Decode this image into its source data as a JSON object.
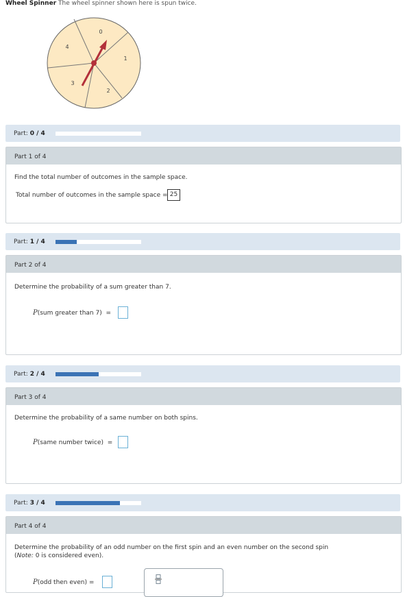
{
  "intro": {
    "title": "Wheel Spinner",
    "description": "The wheel spinner shown here is spun twice."
  },
  "spinner": {
    "numbers": [
      "0",
      "1",
      "2",
      "3",
      "4"
    ],
    "fill_color": "#fde9c3",
    "arrow_color": "#b3303a"
  },
  "progress": [
    {
      "label": "Part:",
      "value": "0 / 4",
      "fraction": 0
    },
    {
      "label": "Part:",
      "value": "1 / 4",
      "fraction": 0.25
    },
    {
      "label": "Part:",
      "value": "2 / 4",
      "fraction": 0.5
    },
    {
      "label": "Part:",
      "value": "3 / 4",
      "fraction": 0.75
    }
  ],
  "parts": [
    {
      "title": "Part 1 of 4",
      "question": "Find the total number of outcomes in the sample space.",
      "answer_label": "Total number of outcomes in the sample space =",
      "answer_value": "25"
    },
    {
      "title": "Part 2 of 4",
      "question": "Determine the probability of a sum greater than 7.",
      "prob_p": "P",
      "prob_arg": "(sum greater than 7)",
      "prob_eq": "="
    },
    {
      "title": "Part 3 of 4",
      "question": "Determine the probability of a same number on both spins.",
      "prob_p": "P",
      "prob_arg": "(same number twice)",
      "prob_eq": "="
    },
    {
      "title": "Part 4 of 4",
      "question": "Determine the probability of an odd number on the first spin and an even number on the second spin",
      "note_open": "(",
      "note_label": "Note:",
      "note_text": "0 is considered even).",
      "prob_p": "P",
      "prob_arg": "(odd then even)",
      "prob_eq": "="
    }
  ],
  "colors": {
    "accent": "#3b73b5",
    "panel_header": "#d1d9de",
    "progress_bg": "#dce6f0"
  }
}
